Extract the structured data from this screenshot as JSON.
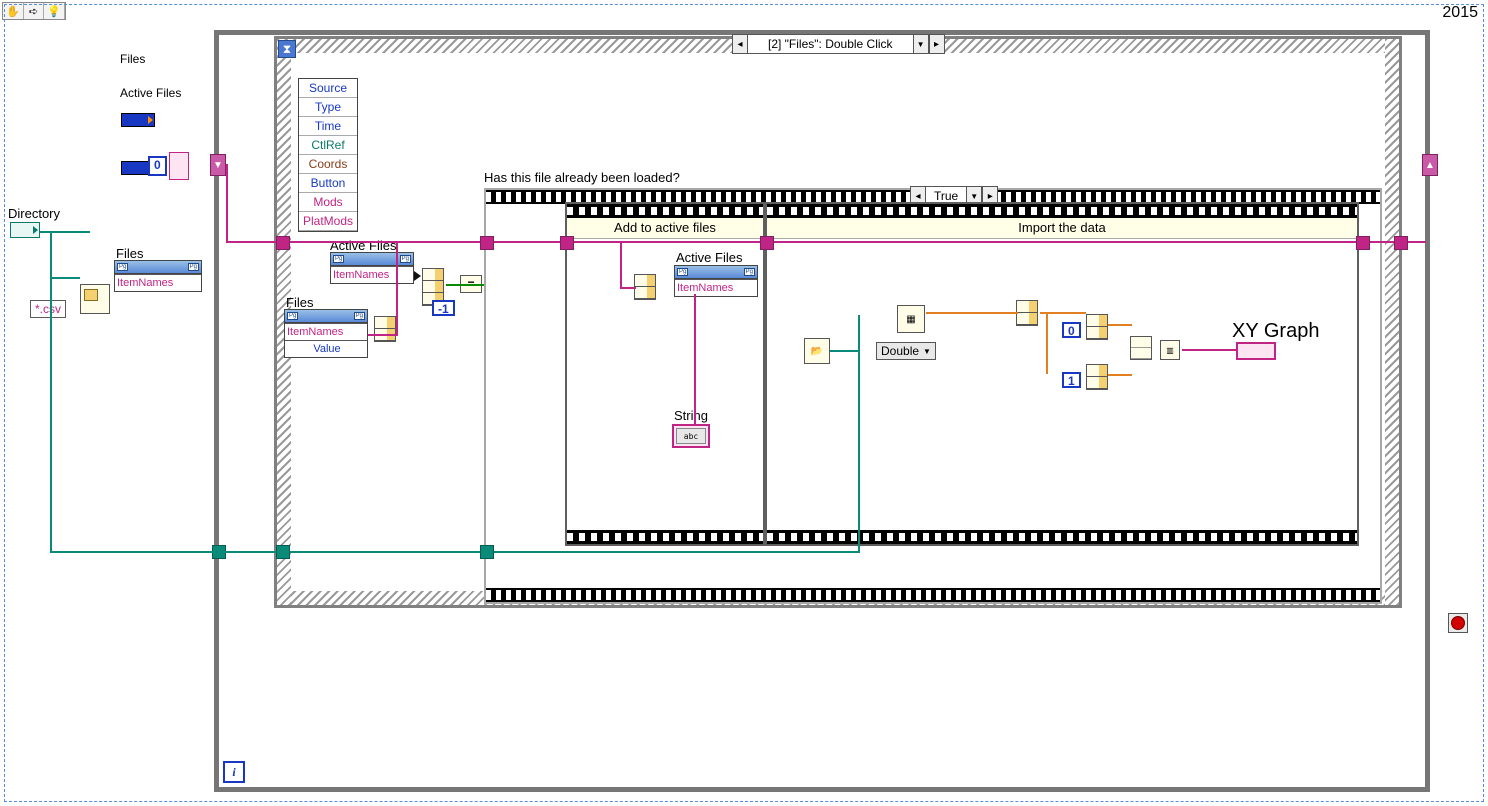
{
  "year_label": "2015",
  "toolbar": {
    "hand": "✋",
    "arrow": "➪",
    "highlight": "💡"
  },
  "controls": {
    "files_label": "Files",
    "active_files_label": "Active Files",
    "directory_label": "Directory",
    "csv_pattern": "*.csv"
  },
  "zero_const": "0",
  "event": {
    "selector": "[2] \"Files\": Double Click",
    "data_items": [
      "Source",
      "Type",
      "Time",
      "CtlRef",
      "Coords",
      "Button",
      "Mods",
      "PlatMods"
    ]
  },
  "prop_item_names": "ItemNames",
  "prop_value": "Value",
  "files_pn_label": "Files",
  "active_files_pn_label": "Active Files",
  "search_const": "-1",
  "case": {
    "question": "Has this file already been loaded?",
    "selector": "True"
  },
  "seq1_title": "Add to active files",
  "seq2_title": "Import the data",
  "string_label": "String",
  "string_abc": "abc",
  "ring_label": "Double",
  "idx0": "0",
  "idx1": "1",
  "xy_label": "XY Graph",
  "iter": "i"
}
